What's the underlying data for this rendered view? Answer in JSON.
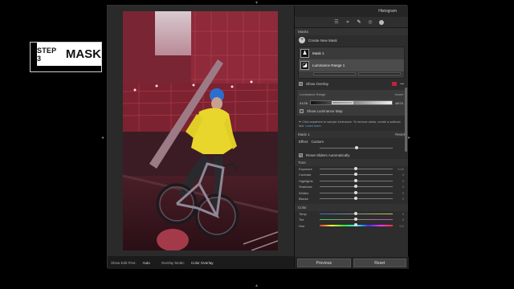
{
  "badge": {
    "step": "STEP 3",
    "word": "MASK"
  },
  "header": {
    "histogram": "Histogram"
  },
  "masks": {
    "section_title": "Masks",
    "create_new": "Create New Mask",
    "items": [
      {
        "label": "Mask 1"
      },
      {
        "label": "Luminance Range 1"
      }
    ],
    "show_overlay": "Show Overlay",
    "overlay_color": "#c0213e"
  },
  "luminance": {
    "title": "Luminance Range",
    "right_label": "Invert",
    "low": "41/26",
    "high": "48/74",
    "range_low": 0.26,
    "range_high": 0.52,
    "show_map": "Show Luminance Map",
    "info": "Click anywhere to sample luminance. To remove areas, create a subtract tool.",
    "learn": "Learn more"
  },
  "mask_section": {
    "title": "Mask 1",
    "right": "Reset",
    "effect_label": "Effect",
    "effect_value": "Custom",
    "reset_sliders": "Reset Sliders Automatically"
  },
  "tone": {
    "title": "Tone",
    "sliders": [
      {
        "label": "Exposure",
        "value": "0.00",
        "pos": 0.5
      },
      {
        "label": "Contrast",
        "value": "0",
        "pos": 0.5
      },
      {
        "label": "Highlights",
        "value": "0",
        "pos": 0.5
      },
      {
        "label": "Shadows",
        "value": "0",
        "pos": 0.5
      },
      {
        "label": "Whites",
        "value": "0",
        "pos": 0.5
      },
      {
        "label": "Blacks",
        "value": "0",
        "pos": 0.5
      }
    ]
  },
  "color": {
    "title": "Color",
    "sliders": [
      {
        "label": "Temp",
        "value": "0",
        "pos": 0.5
      },
      {
        "label": "Tint",
        "value": "0",
        "pos": 0.5
      },
      {
        "label": "Hue",
        "value": "0.0",
        "pos": 0.5
      }
    ]
  },
  "footer": {
    "previous": "Previous",
    "reset": "Reset"
  },
  "bottombar": {
    "show_edit_pins_label": "Show Edit Pins:",
    "show_edit_pins_value": "Auto",
    "overlay_mode_label": "Overlay Mode:",
    "overlay_mode_value": "Color Overlay"
  }
}
